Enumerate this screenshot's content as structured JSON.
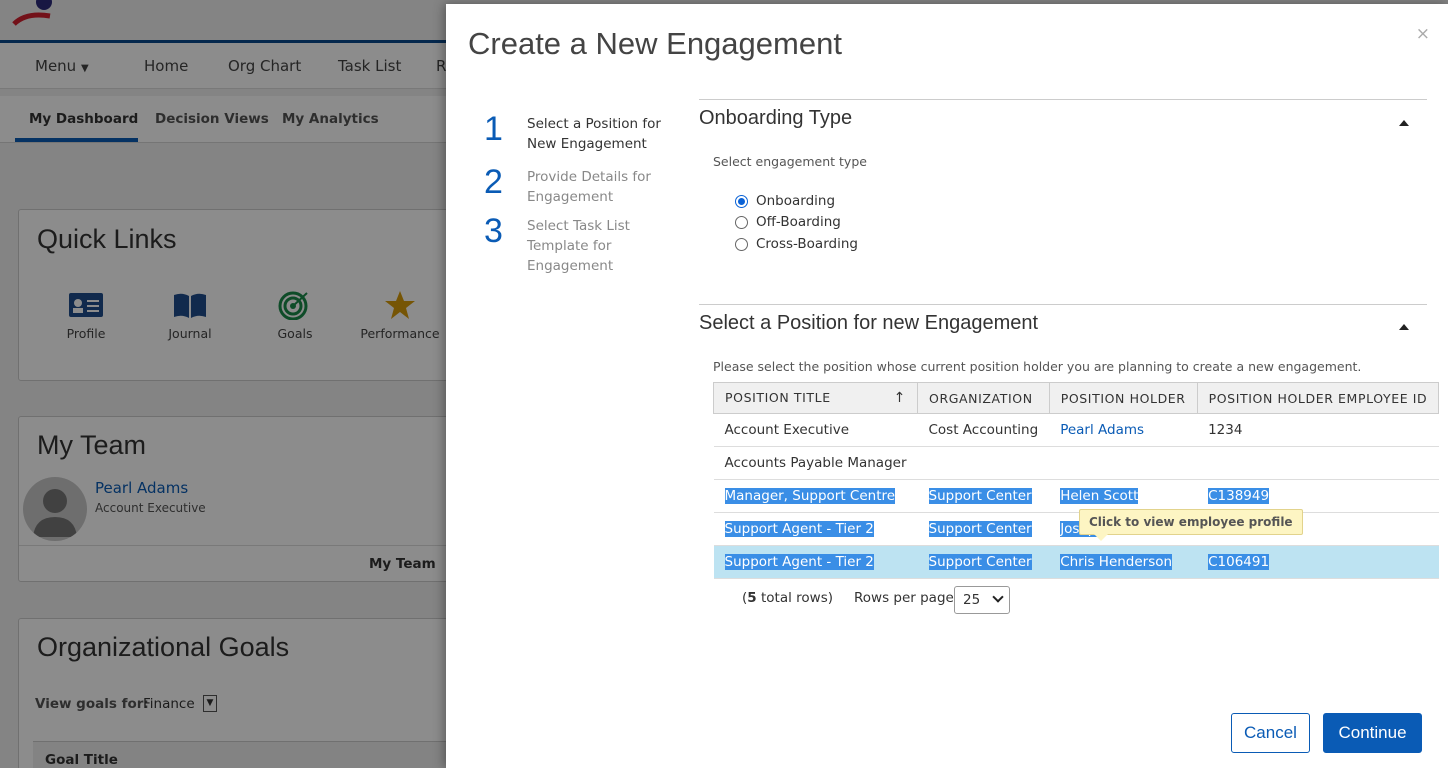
{
  "background": {
    "main_nav": [
      "Menu",
      "Home",
      "Org Chart",
      "Task List",
      "R"
    ],
    "sub_nav": [
      "My Dashboard",
      "Decision Views",
      "My Analytics"
    ],
    "quick_links": {
      "title": "Quick Links",
      "items": [
        {
          "label": "Profile",
          "icon": "profile-card-icon"
        },
        {
          "label": "Journal",
          "icon": "journal-book-icon"
        },
        {
          "label": "Goals",
          "icon": "target-icon"
        },
        {
          "label": "Performance",
          "icon": "star-icon"
        }
      ]
    },
    "my_team": {
      "title": "My Team",
      "member_name": "Pearl Adams",
      "member_role": "Account Executive",
      "footer": "My Team"
    },
    "org_goals": {
      "title": "Organizational Goals",
      "view_label": "View goals for:",
      "view_value": "Finance",
      "column": "Goal Title"
    }
  },
  "modal": {
    "title": "Create a New Engagement",
    "close": "×",
    "steps": [
      {
        "num": "1",
        "label": "Select a Position for New Engagement"
      },
      {
        "num": "2",
        "label": "Provide Details for Engagement"
      },
      {
        "num": "3",
        "label": "Select Task List Template for Engagement"
      }
    ],
    "onboarding": {
      "title": "Onboarding Type",
      "hint": "Select engagement type",
      "options": [
        "Onboarding",
        "Off-Boarding",
        "Cross-Boarding"
      ],
      "selected": "Onboarding"
    },
    "position": {
      "title": "Select a Position for new Engagement",
      "hint": "Please select the position whose current position holder you are planning to create a new engagement.",
      "columns": [
        "POSITION TITLE",
        "ORGANIZATION",
        "POSITION HOLDER",
        "POSITION HOLDER EMPLOYEE ID"
      ],
      "sort_icon": "↑",
      "rows": [
        {
          "title": "Account Executive",
          "org": "Cost Accounting",
          "holder": "Pearl Adams",
          "emp_id": "1234"
        },
        {
          "title": "Accounts Payable Manager",
          "org": "",
          "holder": "",
          "emp_id": ""
        },
        {
          "title": "Manager, Support Centre",
          "org": "Support Center",
          "holder": "Helen Scott",
          "emp_id": "C138949"
        },
        {
          "title": "Support Agent - Tier 2",
          "org": "Support Center",
          "holder": "Joseph",
          "emp_id": ""
        },
        {
          "title": "Support Agent - Tier 2",
          "org": "Support Center",
          "holder": "Chris Henderson",
          "emp_id": "C106491"
        }
      ],
      "tooltip": "Click to view employee profile",
      "total_count": "5",
      "total_suffix": "total rows)",
      "rows_per_page_label": "Rows per page:",
      "rows_per_page": "25"
    },
    "buttons": {
      "cancel": "Cancel",
      "continue": "Continue"
    }
  }
}
